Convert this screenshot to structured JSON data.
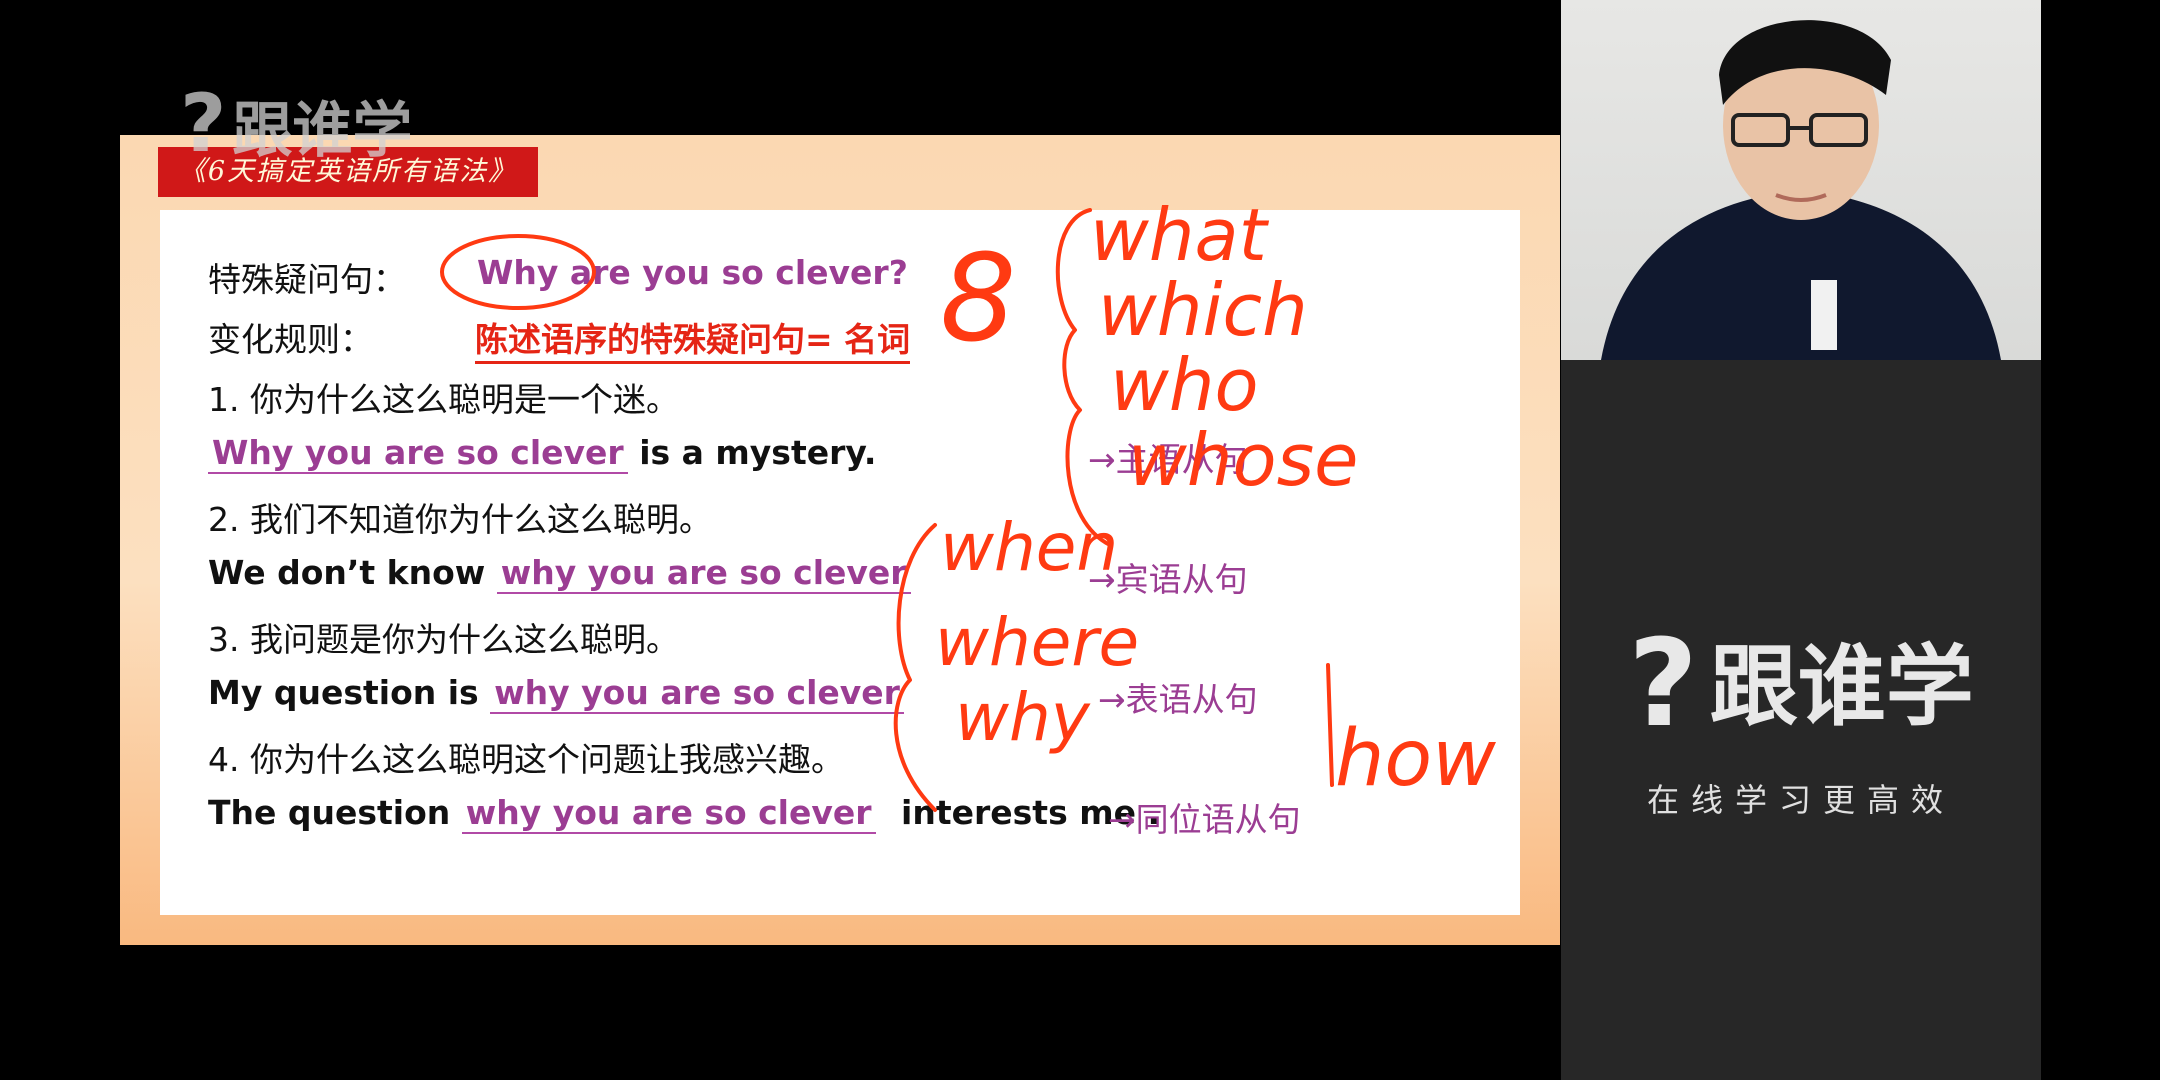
{
  "slide": {
    "course_title": "《6天搞定英语所有语法》",
    "watermark": "跟谁学",
    "row1_label": "特殊疑问句：",
    "row1_example": "Why are you so clever?",
    "row2_label": "变化规则：",
    "row2_rule": "陈述语序的特殊疑问句= 名词",
    "items": [
      {
        "cn": "1. 你为什么这么聪明是一个迷。",
        "en_pre": "",
        "en_clause": "Why you are so clever",
        "en_post": "is a mystery.",
        "tag": "→主语从句"
      },
      {
        "cn": "2. 我们不知道你为什么这么聪明。",
        "en_pre": "We don’t know",
        "en_clause": "why you are so clever",
        "en_post": "",
        "tag": "→宾语从句"
      },
      {
        "cn": "3. 我问题是你为什么这么聪明。",
        "en_pre": "My question is",
        "en_clause": "why you are so clever",
        "en_post": "",
        "tag": "→表语从句"
      },
      {
        "cn": "4. 你为什么这么聪明这个问题让我感兴趣。",
        "en_pre": "The question",
        "en_clause": "why you are so clever",
        "en_post": "interests me .",
        "tag": "→同位语从句"
      }
    ]
  },
  "annotations": {
    "number": "8",
    "wh_group_1": [
      "what",
      "which",
      "who",
      "whose"
    ],
    "wh_group_2": [
      "when",
      "where",
      "why"
    ],
    "extra": "how",
    "color": "#ff3a12"
  },
  "brand_panel": {
    "logo_text": "跟谁学",
    "slogan": "在线学习更高效"
  },
  "colors": {
    "title_bg": "#d01818",
    "clause_purple": "#9b3d93",
    "rule_red": "#e52515"
  }
}
